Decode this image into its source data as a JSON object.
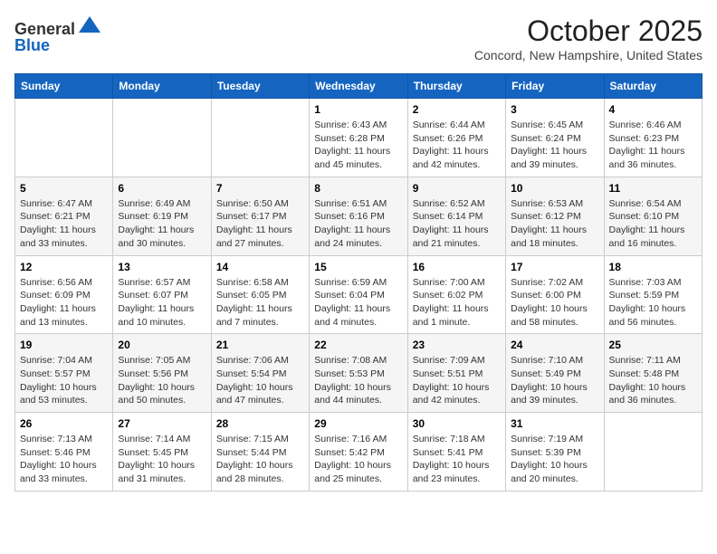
{
  "header": {
    "logo_line1": "General",
    "logo_line2": "Blue",
    "month": "October 2025",
    "location": "Concord, New Hampshire, United States"
  },
  "weekdays": [
    "Sunday",
    "Monday",
    "Tuesday",
    "Wednesday",
    "Thursday",
    "Friday",
    "Saturday"
  ],
  "weeks": [
    [
      {
        "day": "",
        "sunrise": "",
        "sunset": "",
        "daylight": ""
      },
      {
        "day": "",
        "sunrise": "",
        "sunset": "",
        "daylight": ""
      },
      {
        "day": "",
        "sunrise": "",
        "sunset": "",
        "daylight": ""
      },
      {
        "day": "1",
        "sunrise": "Sunrise: 6:43 AM",
        "sunset": "Sunset: 6:28 PM",
        "daylight": "Daylight: 11 hours and 45 minutes."
      },
      {
        "day": "2",
        "sunrise": "Sunrise: 6:44 AM",
        "sunset": "Sunset: 6:26 PM",
        "daylight": "Daylight: 11 hours and 42 minutes."
      },
      {
        "day": "3",
        "sunrise": "Sunrise: 6:45 AM",
        "sunset": "Sunset: 6:24 PM",
        "daylight": "Daylight: 11 hours and 39 minutes."
      },
      {
        "day": "4",
        "sunrise": "Sunrise: 6:46 AM",
        "sunset": "Sunset: 6:23 PM",
        "daylight": "Daylight: 11 hours and 36 minutes."
      }
    ],
    [
      {
        "day": "5",
        "sunrise": "Sunrise: 6:47 AM",
        "sunset": "Sunset: 6:21 PM",
        "daylight": "Daylight: 11 hours and 33 minutes."
      },
      {
        "day": "6",
        "sunrise": "Sunrise: 6:49 AM",
        "sunset": "Sunset: 6:19 PM",
        "daylight": "Daylight: 11 hours and 30 minutes."
      },
      {
        "day": "7",
        "sunrise": "Sunrise: 6:50 AM",
        "sunset": "Sunset: 6:17 PM",
        "daylight": "Daylight: 11 hours and 27 minutes."
      },
      {
        "day": "8",
        "sunrise": "Sunrise: 6:51 AM",
        "sunset": "Sunset: 6:16 PM",
        "daylight": "Daylight: 11 hours and 24 minutes."
      },
      {
        "day": "9",
        "sunrise": "Sunrise: 6:52 AM",
        "sunset": "Sunset: 6:14 PM",
        "daylight": "Daylight: 11 hours and 21 minutes."
      },
      {
        "day": "10",
        "sunrise": "Sunrise: 6:53 AM",
        "sunset": "Sunset: 6:12 PM",
        "daylight": "Daylight: 11 hours and 18 minutes."
      },
      {
        "day": "11",
        "sunrise": "Sunrise: 6:54 AM",
        "sunset": "Sunset: 6:10 PM",
        "daylight": "Daylight: 11 hours and 16 minutes."
      }
    ],
    [
      {
        "day": "12",
        "sunrise": "Sunrise: 6:56 AM",
        "sunset": "Sunset: 6:09 PM",
        "daylight": "Daylight: 11 hours and 13 minutes."
      },
      {
        "day": "13",
        "sunrise": "Sunrise: 6:57 AM",
        "sunset": "Sunset: 6:07 PM",
        "daylight": "Daylight: 11 hours and 10 minutes."
      },
      {
        "day": "14",
        "sunrise": "Sunrise: 6:58 AM",
        "sunset": "Sunset: 6:05 PM",
        "daylight": "Daylight: 11 hours and 7 minutes."
      },
      {
        "day": "15",
        "sunrise": "Sunrise: 6:59 AM",
        "sunset": "Sunset: 6:04 PM",
        "daylight": "Daylight: 11 hours and 4 minutes."
      },
      {
        "day": "16",
        "sunrise": "Sunrise: 7:00 AM",
        "sunset": "Sunset: 6:02 PM",
        "daylight": "Daylight: 11 hours and 1 minute."
      },
      {
        "day": "17",
        "sunrise": "Sunrise: 7:02 AM",
        "sunset": "Sunset: 6:00 PM",
        "daylight": "Daylight: 10 hours and 58 minutes."
      },
      {
        "day": "18",
        "sunrise": "Sunrise: 7:03 AM",
        "sunset": "Sunset: 5:59 PM",
        "daylight": "Daylight: 10 hours and 56 minutes."
      }
    ],
    [
      {
        "day": "19",
        "sunrise": "Sunrise: 7:04 AM",
        "sunset": "Sunset: 5:57 PM",
        "daylight": "Daylight: 10 hours and 53 minutes."
      },
      {
        "day": "20",
        "sunrise": "Sunrise: 7:05 AM",
        "sunset": "Sunset: 5:56 PM",
        "daylight": "Daylight: 10 hours and 50 minutes."
      },
      {
        "day": "21",
        "sunrise": "Sunrise: 7:06 AM",
        "sunset": "Sunset: 5:54 PM",
        "daylight": "Daylight: 10 hours and 47 minutes."
      },
      {
        "day": "22",
        "sunrise": "Sunrise: 7:08 AM",
        "sunset": "Sunset: 5:53 PM",
        "daylight": "Daylight: 10 hours and 44 minutes."
      },
      {
        "day": "23",
        "sunrise": "Sunrise: 7:09 AM",
        "sunset": "Sunset: 5:51 PM",
        "daylight": "Daylight: 10 hours and 42 minutes."
      },
      {
        "day": "24",
        "sunrise": "Sunrise: 7:10 AM",
        "sunset": "Sunset: 5:49 PM",
        "daylight": "Daylight: 10 hours and 39 minutes."
      },
      {
        "day": "25",
        "sunrise": "Sunrise: 7:11 AM",
        "sunset": "Sunset: 5:48 PM",
        "daylight": "Daylight: 10 hours and 36 minutes."
      }
    ],
    [
      {
        "day": "26",
        "sunrise": "Sunrise: 7:13 AM",
        "sunset": "Sunset: 5:46 PM",
        "daylight": "Daylight: 10 hours and 33 minutes."
      },
      {
        "day": "27",
        "sunrise": "Sunrise: 7:14 AM",
        "sunset": "Sunset: 5:45 PM",
        "daylight": "Daylight: 10 hours and 31 minutes."
      },
      {
        "day": "28",
        "sunrise": "Sunrise: 7:15 AM",
        "sunset": "Sunset: 5:44 PM",
        "daylight": "Daylight: 10 hours and 28 minutes."
      },
      {
        "day": "29",
        "sunrise": "Sunrise: 7:16 AM",
        "sunset": "Sunset: 5:42 PM",
        "daylight": "Daylight: 10 hours and 25 minutes."
      },
      {
        "day": "30",
        "sunrise": "Sunrise: 7:18 AM",
        "sunset": "Sunset: 5:41 PM",
        "daylight": "Daylight: 10 hours and 23 minutes."
      },
      {
        "day": "31",
        "sunrise": "Sunrise: 7:19 AM",
        "sunset": "Sunset: 5:39 PM",
        "daylight": "Daylight: 10 hours and 20 minutes."
      },
      {
        "day": "",
        "sunrise": "",
        "sunset": "",
        "daylight": ""
      }
    ]
  ]
}
